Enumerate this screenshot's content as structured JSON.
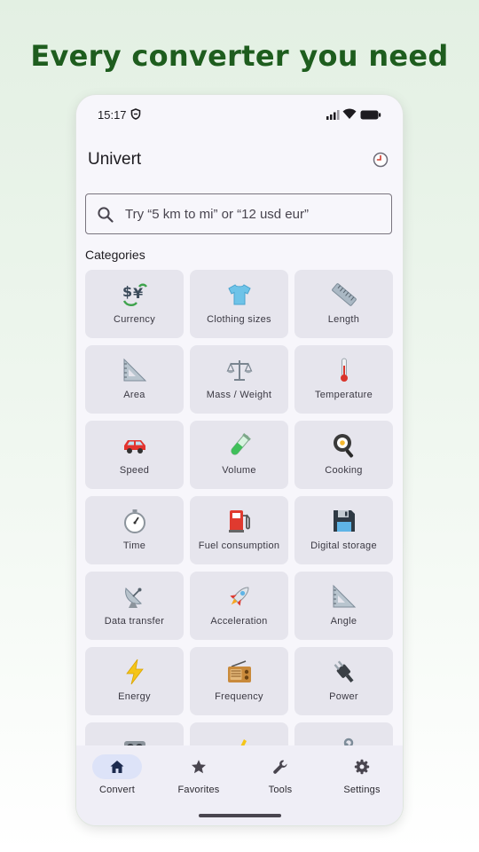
{
  "headline": "Every converter you need",
  "status_bar": {
    "time": "15:17"
  },
  "app_bar": {
    "title": "Univert",
    "history_icon": "clock-icon"
  },
  "search": {
    "placeholder": "Try “5 km to mi” or “12 usd eur”"
  },
  "categories_heading": "Categories",
  "categories": [
    {
      "label": "Currency",
      "icon": "currency-exchange-icon"
    },
    {
      "label": "Clothing sizes",
      "icon": "tshirt-icon"
    },
    {
      "label": "Length",
      "icon": "ruler-icon"
    },
    {
      "label": "Area",
      "icon": "triangular-ruler-icon"
    },
    {
      "label": "Mass / Weight",
      "icon": "balance-scale-icon"
    },
    {
      "label": "Temperature",
      "icon": "thermometer-icon"
    },
    {
      "label": "Speed",
      "icon": "car-icon"
    },
    {
      "label": "Volume",
      "icon": "test-tube-icon"
    },
    {
      "label": "Cooking",
      "icon": "frying-pan-icon"
    },
    {
      "label": "Time",
      "icon": "stopwatch-icon"
    },
    {
      "label": "Fuel consumption",
      "icon": "fuel-pump-icon"
    },
    {
      "label": "Digital storage",
      "icon": "floppy-disk-icon"
    },
    {
      "label": "Data transfer",
      "icon": "satellite-dish-icon"
    },
    {
      "label": "Acceleration",
      "icon": "rocket-icon"
    },
    {
      "label": "Angle",
      "icon": "triangular-ruler-icon"
    },
    {
      "label": "Energy",
      "icon": "lightning-icon"
    },
    {
      "label": "Frequency",
      "icon": "radio-icon"
    },
    {
      "label": "Power",
      "icon": "electric-plug-icon"
    },
    {
      "label": "",
      "icon": "partial-icon"
    },
    {
      "label": "",
      "icon": "partial-icon"
    },
    {
      "label": "",
      "icon": "partial-icon"
    }
  ],
  "bottom_nav": [
    {
      "label": "Convert",
      "icon": "home-icon",
      "active": true
    },
    {
      "label": "Favorites",
      "icon": "star-icon",
      "active": false
    },
    {
      "label": "Tools",
      "icon": "wrench-icon",
      "active": false
    },
    {
      "label": "Settings",
      "icon": "gear-icon",
      "active": false
    }
  ],
  "colors": {
    "headline": "#1e5d1e",
    "tile": "#e6e5ed",
    "nav_active_pill": "#dde3f8"
  }
}
